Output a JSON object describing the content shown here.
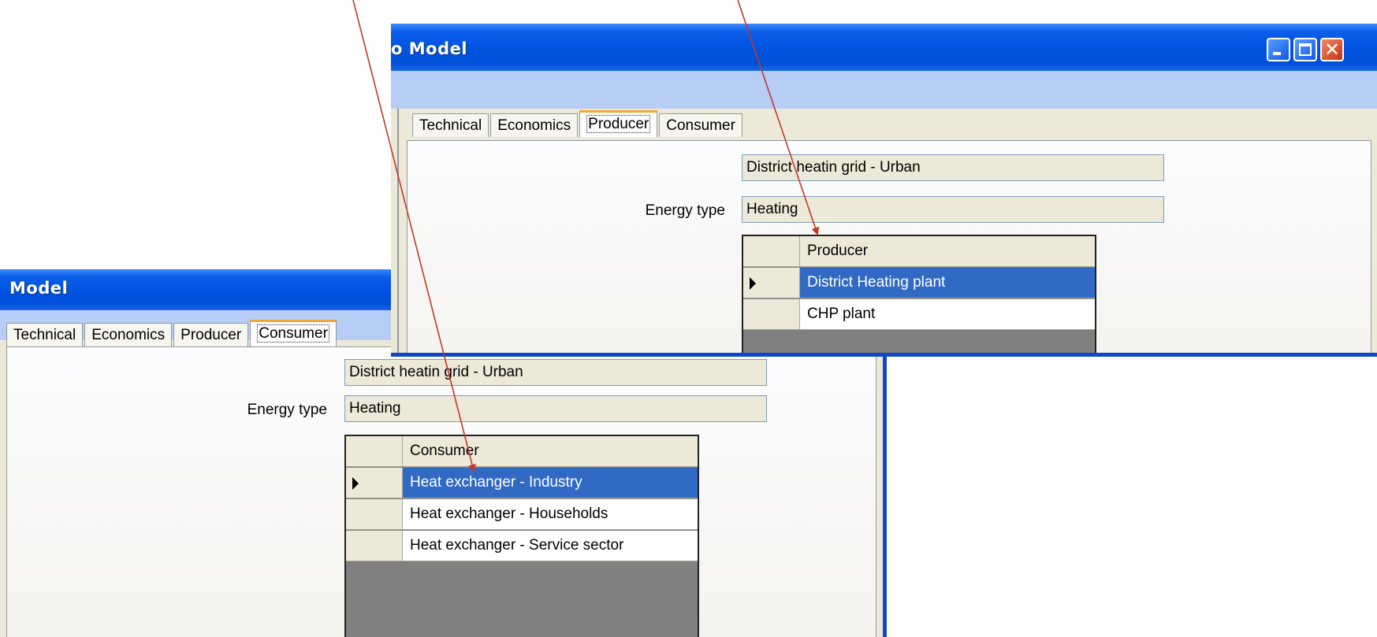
{
  "bottom_window": {
    "title": "Model",
    "tabs": [
      "Technical",
      "Economics",
      "Producer",
      "Consumer"
    ],
    "active_tab": "Consumer",
    "name_field": "District heatin grid  - Urban",
    "energy_label": "Energy type",
    "energy_value": "Heating",
    "grid_header": "Consumer",
    "grid_rows": [
      "Heat exchanger - Industry",
      "Heat exchanger - Households",
      "Heat exchanger - Service sector"
    ]
  },
  "top_window": {
    "title": "o Model",
    "tabs": [
      "Technical",
      "Economics",
      "Producer",
      "Consumer"
    ],
    "active_tab": "Producer",
    "name_field": "District heatin grid  - Urban",
    "energy_label": "Energy type",
    "energy_value": "Heating",
    "grid_header": "Producer",
    "grid_rows": [
      "District Heating plant",
      "CHP plant"
    ]
  },
  "colors": {
    "titlebar": "#0053e0",
    "selection": "#316ac5",
    "active_tab_accent": "#f0a830",
    "annotation_arrow": "#c0392b"
  },
  "icons": [
    "minimize-icon",
    "maximize-icon",
    "close-icon",
    "row-pointer-icon"
  ]
}
